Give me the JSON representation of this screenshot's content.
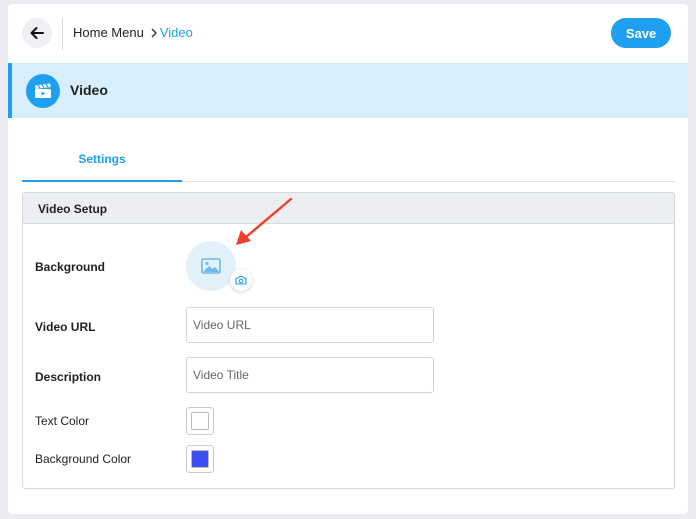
{
  "header": {
    "breadcrumb_home": "Home Menu",
    "breadcrumb_current": "Video",
    "save_label": "Save"
  },
  "section": {
    "title": "Video"
  },
  "tabs": [
    {
      "label": "Settings",
      "active": true
    }
  ],
  "panel": {
    "title": "Video Setup",
    "fields": {
      "background_label": "Background",
      "video_url_label": "Video URL",
      "video_url_placeholder": "Video URL",
      "video_url_value": "",
      "description_label": "Description",
      "description_placeholder": "Video Title",
      "description_value": "",
      "text_color_label": "Text Color",
      "text_color_value": "#ffffff",
      "background_color_label": "Background Color",
      "background_color_value": "#3d4cf5"
    }
  },
  "colors": {
    "accent": "#1f9ff0",
    "header_bg": "#d8effb",
    "annotation_arrow": "#f0402a"
  },
  "icons": {
    "back": "arrow-left-icon",
    "breadcrumb_separator": "chevron-right-icon",
    "section": "clapperboard-icon",
    "background_picker": "image-icon",
    "upload": "camera-icon"
  }
}
